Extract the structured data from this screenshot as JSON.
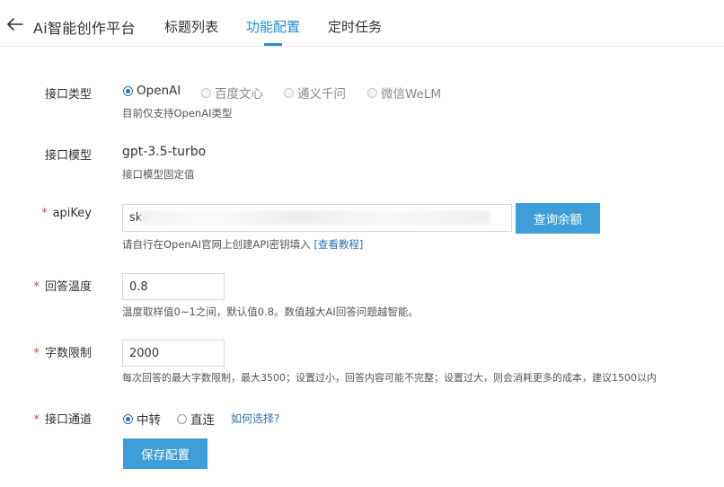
{
  "header": {
    "title": "Ai智能创作平台",
    "tabs": [
      {
        "label": "标题列表"
      },
      {
        "label": "功能配置",
        "active": true
      },
      {
        "label": "定时任务"
      }
    ]
  },
  "form": {
    "api_type": {
      "label": "接口类型",
      "options": [
        "OpenAI",
        "百度文心",
        "通义千问",
        "微信WeLM"
      ],
      "selected": "OpenAI",
      "hint": "目前仅支持OpenAI类型"
    },
    "model": {
      "label": "接口模型",
      "value": "gpt-3.5-turbo",
      "hint": "接口模型固定值"
    },
    "api_key": {
      "required": "*",
      "label": "apiKey",
      "value": "sk-",
      "button": "查询余额",
      "hint": "请自行在OpenAI官网上创建API密钥填入",
      "link": "[查看教程]"
    },
    "temperature": {
      "required": "*",
      "label": "回答温度",
      "value": "0.8",
      "hint": "温度取样值0~1之间，默认值0.8。数值越大AI回答问题越智能。"
    },
    "word_limit": {
      "required": "*",
      "label": "字数限制",
      "value": "2000",
      "hint": "每次回答的最大字数限制，最大3500；设置过小，回答内容可能不完整；设置过大，则会消耗更多的成本，建议1500以内"
    },
    "channel": {
      "required": "*",
      "label": "接口通道",
      "options": [
        "中转",
        "直连"
      ],
      "selected": "中转",
      "help_link": "如何选择?"
    },
    "save_button": "保存配置"
  },
  "colors": {
    "accent": "#1f8fcf",
    "button": "#3d9ed9",
    "required": "#e64545"
  }
}
